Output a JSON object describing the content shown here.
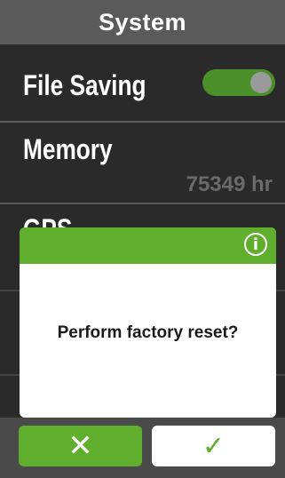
{
  "header": {
    "title": "System"
  },
  "settings": {
    "file_saving": {
      "label": "File Saving",
      "enabled": true
    },
    "memory": {
      "label": "Memory",
      "value": "75349 hr"
    },
    "gps": {
      "label": "GPS"
    }
  },
  "dialog": {
    "message": "Perform factory reset?",
    "info_icon": "i",
    "cancel_icon": "✕",
    "confirm_icon": "✓"
  },
  "colors": {
    "accent": "#5fae2e",
    "header_bg": "#5a5a5a",
    "background": "#2a2a2a"
  }
}
